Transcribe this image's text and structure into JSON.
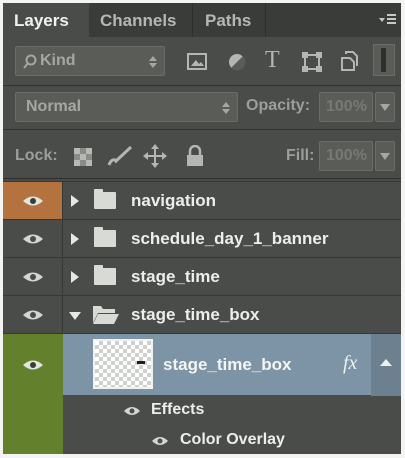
{
  "tabs": {
    "layers": "Layers",
    "channels": "Channels",
    "paths": "Paths"
  },
  "filter": {
    "kind_label": "Kind"
  },
  "blend": {
    "mode": "Normal",
    "opacity_label": "Opacity:",
    "opacity_value": "100%"
  },
  "lock": {
    "label": "Lock:",
    "fill_label": "Fill:",
    "fill_value": "100%"
  },
  "layers": [
    {
      "name": "navigation"
    },
    {
      "name": "schedule_day_1_banner"
    },
    {
      "name": "stage_time"
    },
    {
      "name": "stage_time_box"
    },
    {
      "name": "stage_time_box",
      "fx": "fx"
    }
  ],
  "effects": {
    "label": "Effects",
    "items": [
      "Color Overlay"
    ]
  },
  "colors": {
    "panel": "#4a4c49",
    "selected_row": "#7d93a6",
    "eye_orange": "#b4733e",
    "eye_green": "#63812d"
  },
  "icons": {
    "search": "search-icon",
    "image_filter": "image-filter-icon",
    "adjustment_filter": "adjustment-filter-icon",
    "type_filter": "type-filter-icon",
    "shape_filter": "shape-filter-icon",
    "smart_object_filter": "smart-object-filter-icon",
    "panel_menu": "panel-menu-icon",
    "lock_pixels": "lock-transparent-pixels-icon",
    "lock_image": "lock-image-pixels-icon",
    "lock_position": "lock-position-icon",
    "lock_all": "lock-all-icon",
    "eye": "eye-icon",
    "folder": "folder-icon",
    "folder_open": "folder-open-icon",
    "fx": "fx-icon"
  }
}
